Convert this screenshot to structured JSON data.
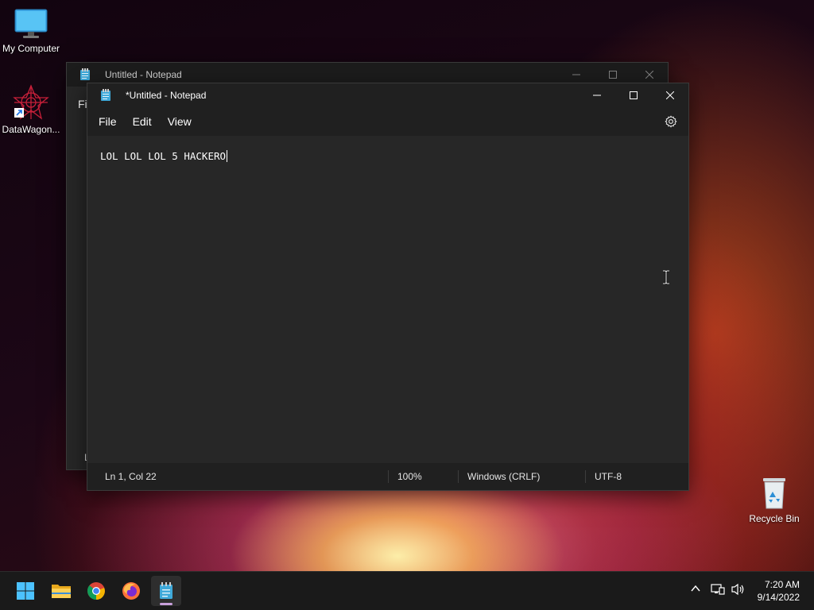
{
  "desktop": {
    "icons": [
      {
        "label": "My Computer",
        "icon": "monitor-icon"
      },
      {
        "label": "DataWagon...",
        "icon": "datawagon-icon"
      },
      {
        "label": "Recycle Bin",
        "icon": "recycle-bin-icon"
      }
    ]
  },
  "back_window": {
    "title": "Untitled - Notepad",
    "menu_partial": "Fil",
    "status_partial": "L"
  },
  "front_window": {
    "title": "*Untitled - Notepad",
    "menu": [
      "File",
      "Edit",
      "View"
    ],
    "content": "LOL LOL LOL 5 HACKERO",
    "status": {
      "position": "Ln 1, Col 22",
      "zoom": "100%",
      "line_ending": "Windows (CRLF)",
      "encoding": "UTF-8"
    }
  },
  "taskbar": {
    "apps": [
      "start-icon",
      "file-explorer-icon",
      "chrome-icon",
      "firefox-icon",
      "notepad-icon"
    ],
    "active_app": "notepad-icon",
    "time": "7:20 AM",
    "date": "9/14/2022"
  },
  "colors": {
    "window_bg": "#272727",
    "titlebar_bg": "#202020",
    "taskbar_bg": "#1a1a1a",
    "accent": "#60cdff"
  }
}
